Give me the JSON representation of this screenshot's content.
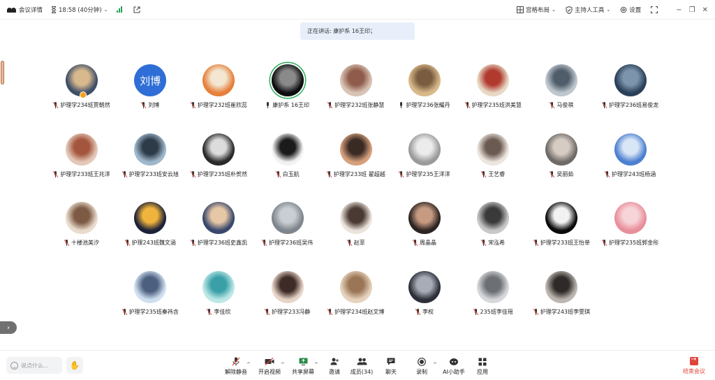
{
  "topbar": {
    "meeting_info_label": "会议详情",
    "timer_label": "18:58 (40分钟)",
    "layout_label": "宫格布局",
    "host_tools_label": "主持人工具",
    "settings_label": "设置"
  },
  "speaking": {
    "label": "正在讲话: 康护系 16王印；"
  },
  "participants": [
    {
      "name": "护理学234班贾朝然",
      "muted": true,
      "colors": [
        "#3e4e68",
        "#d8b98e"
      ]
    },
    {
      "name": "刘博",
      "muted": true,
      "avatar_text": "刘博",
      "colors": [
        "#2f6ed6",
        "#2f6ed6"
      ]
    },
    {
      "name": "护理学232班崔欣蕊",
      "muted": true,
      "colors": [
        "#e67f3a",
        "#f3e7d2"
      ]
    },
    {
      "name": "康护系 16王印",
      "muted": false,
      "active": true,
      "colors": [
        "#0e0e10",
        "#8a8a8a"
      ]
    },
    {
      "name": "护理学232班张静慧",
      "muted": true,
      "colors": [
        "#d8c4b5",
        "#8f5b4b"
      ]
    },
    {
      "name": "护理学236张耀丹",
      "muted": false,
      "colors": [
        "#d8b98a",
        "#7a5c40"
      ]
    },
    {
      "name": "护理学235班洪美慧",
      "muted": true,
      "colors": [
        "#e8d9c6",
        "#b03a2e"
      ]
    },
    {
      "name": "马俊祺",
      "muted": true,
      "colors": [
        "#bfc7cf",
        "#4f5d6a"
      ]
    },
    {
      "name": "护理学236班易俊龙",
      "muted": true,
      "colors": [
        "#2a4058",
        "#7c95ad"
      ]
    },
    {
      "name": "护理学233班王兆洋",
      "muted": true,
      "colors": [
        "#e4c9b9",
        "#a4553d"
      ]
    },
    {
      "name": "护理学233班安云旭",
      "muted": true,
      "colors": [
        "#9fb8cc",
        "#2d3a48"
      ]
    },
    {
      "name": "护理学235班朴贺然",
      "muted": true,
      "colors": [
        "#2a2a2a",
        "#dcdcdc"
      ]
    },
    {
      "name": "白玉航",
      "muted": true,
      "colors": [
        "#f2f2f2",
        "#1b1b1b"
      ]
    },
    {
      "name": "护理学233班 翟超越",
      "muted": true,
      "colors": [
        "#d6a07c",
        "#3a2a24"
      ]
    },
    {
      "name": "护理学235王洋洋",
      "muted": true,
      "colors": [
        "#9a9a9a",
        "#ececec"
      ]
    },
    {
      "name": "王艺睿",
      "muted": true,
      "colors": [
        "#ece6df",
        "#6b5a52"
      ]
    },
    {
      "name": "吴丽茹",
      "muted": true,
      "colors": [
        "#6f6a66",
        "#d7ccc3"
      ]
    },
    {
      "name": "护理学243班杨涵",
      "muted": true,
      "colors": [
        "#4d7fd0",
        "#d9e6f6"
      ]
    },
    {
      "name": "十楼池美汐",
      "muted": true,
      "colors": [
        "#e9dccd",
        "#7d5a44"
      ]
    },
    {
      "name": "护理243班魏文涵",
      "muted": true,
      "colors": [
        "#1c2238",
        "#f0b33c"
      ]
    },
    {
      "name": "护理学236班史鑫凯",
      "muted": true,
      "colors": [
        "#39486c",
        "#e7c8a6"
      ]
    },
    {
      "name": "护理学236班吴伟",
      "muted": true,
      "colors": [
        "#7e858c",
        "#c8ced3"
      ]
    },
    {
      "name": "赵菲",
      "muted": true,
      "colors": [
        "#ece4dc",
        "#4a3a33"
      ]
    },
    {
      "name": "周晶晶",
      "muted": true,
      "colors": [
        "#2c2422",
        "#c79a82"
      ]
    },
    {
      "name": "宋泓希",
      "muted": true,
      "colors": [
        "#c8c8c8",
        "#3a3a3a"
      ]
    },
    {
      "name": "护理学233班王怡单",
      "muted": true,
      "colors": [
        "#0a0a0a",
        "#f2f2f2"
      ]
    },
    {
      "name": "护理学235班郭金彤",
      "muted": true,
      "colors": [
        "#e88f9a",
        "#f7d4d8"
      ]
    },
    {
      "name": "护理学235班秦祎含",
      "muted": true,
      "colors": [
        "#cfdff0",
        "#4c5f7e"
      ]
    },
    {
      "name": "李佳欣",
      "muted": true,
      "colors": [
        "#bde7e6",
        "#3aa0a8"
      ]
    },
    {
      "name": "护理学233冯静",
      "muted": true,
      "colors": [
        "#e7d4c8",
        "#3e2a26"
      ]
    },
    {
      "name": "护理学234班赵文博",
      "muted": true,
      "colors": [
        "#e6d2bd",
        "#9a7656"
      ]
    },
    {
      "name": "李权",
      "muted": true,
      "colors": [
        "#2b2f38",
        "#a7acb6"
      ]
    },
    {
      "name": "235班李佳瑶",
      "muted": true,
      "colors": [
        "#d6d8db",
        "#6c6f74"
      ]
    },
    {
      "name": "护理学243班李雯琪",
      "muted": true,
      "colors": [
        "#bdb6b0",
        "#2f2a28"
      ]
    }
  ],
  "bottombar": {
    "chat_placeholder": "说点什么...",
    "unmute_label": "解除静音",
    "video_label": "开启视频",
    "share_label": "共享屏幕",
    "invite_label": "邀请",
    "members_label": "成员(34)",
    "chat_label": "聊天",
    "record_label": "录制",
    "ai_label": "AI小助手",
    "apps_label": "应用",
    "end_label": "结束会议"
  },
  "icons": {
    "signal": "signal-icon",
    "hourglass": "hourglass-icon",
    "share": "external-link-icon",
    "grid": "grid-layout-icon",
    "shield": "shield-icon",
    "gear": "gear-icon",
    "fullscreen": "fullscreen-icon"
  },
  "colors": {
    "accent_green": "#29b05a",
    "end_red": "#e0433a",
    "banner_bg": "#e8effa"
  }
}
